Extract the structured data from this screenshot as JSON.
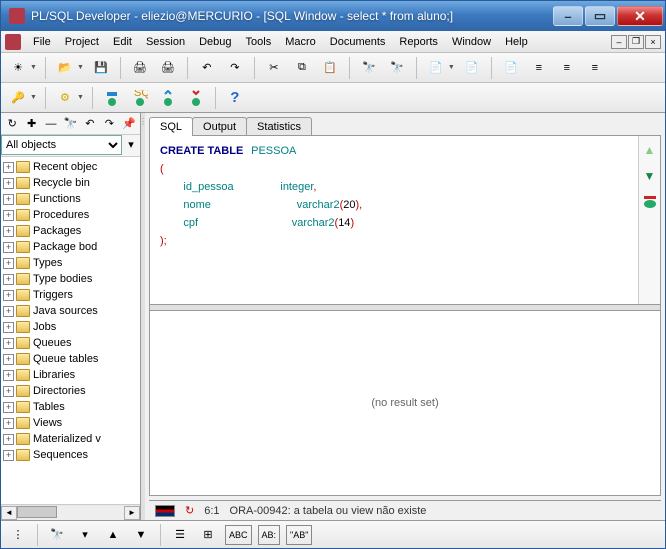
{
  "titlebar": {
    "text": "PL/SQL Developer - eliezio@MERCURIO - [SQL Window - select * from aluno;]"
  },
  "menus": [
    "File",
    "Project",
    "Edit",
    "Session",
    "Debug",
    "Tools",
    "Macro",
    "Documents",
    "Reports",
    "Window",
    "Help"
  ],
  "sidebar": {
    "filter": "All objects",
    "items": [
      "Recent objec",
      "Recycle bin",
      "Functions",
      "Procedures",
      "Packages",
      "Package bod",
      "Types",
      "Type bodies",
      "Triggers",
      "Java sources",
      "Jobs",
      "Queues",
      "Queue tables",
      "Libraries",
      "Directories",
      "Tables",
      "Views",
      "Materialized v",
      "Sequences"
    ]
  },
  "tabs": [
    "SQL",
    "Output",
    "Statistics"
  ],
  "active_tab": 0,
  "sql": {
    "l1_kw": "CREATE TABLE",
    "l1_ident": "PESSOA",
    "l2": "(",
    "l3_col": "id_pessoa",
    "l3_type": "integer",
    "l3_p": ",",
    "l4_col": "nome",
    "l4_type": "varchar2",
    "l4_p1": "(",
    "l4_n": "20",
    "l4_p2": "),",
    "l5_col": "cpf",
    "l5_type": "varchar2",
    "l5_p1": "(",
    "l5_n": "14",
    "l5_p2": ")",
    "l6": ");"
  },
  "results": {
    "text": "(no result set)"
  },
  "status": {
    "pos": "6:1",
    "err": "ORA-00942: a tabela ou view não existe"
  },
  "bottom_labels": {
    "abc1": "ABC",
    "abc2": "AB:",
    "ab": "\"AB\""
  }
}
